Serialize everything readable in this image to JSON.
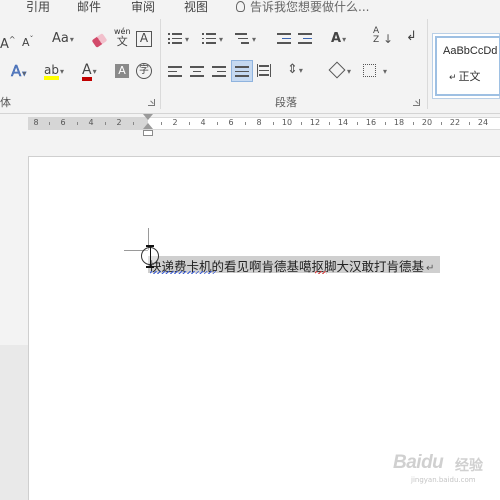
{
  "menu": {
    "tabs": [
      "引用",
      "邮件",
      "审阅",
      "视图"
    ],
    "tell_me": "告诉我您想要做什么..."
  },
  "ribbon": {
    "font_group_label": "体",
    "paragraph_group_label": "段落",
    "font_row1": {
      "grow": "A",
      "shrink": "A",
      "change_case": "Aa",
      "pinyin_top": "wén",
      "pinyin_bottom": "文",
      "char_border": "A"
    },
    "font_row2": {
      "text_effects": "A",
      "highlight": "ab",
      "font_color": "A",
      "char_shading": "A",
      "enclose": "字"
    },
    "para_row1": {
      "chinese_layout": "A",
      "sort": "A",
      "sort_sub": "Z",
      "show_marks": "↲"
    },
    "styles": {
      "preview": "AaBbCcDd",
      "name": "正文",
      "name_mark": "↵"
    }
  },
  "ruler": {
    "left_numbers": [
      "8",
      "6",
      "4",
      "2"
    ],
    "right_numbers": [
      "2",
      "4",
      "6",
      "8",
      "10",
      "12",
      "14",
      "16",
      "18",
      "20",
      "22",
      "24"
    ]
  },
  "document": {
    "text": "快递费卡机的看见啊肯德基噶抠脚大汉敢打肯德基",
    "paragraph_mark": "↵"
  },
  "watermark": {
    "brand": "Baidu",
    "sub": "经验",
    "url": "jingyan.baidu.com"
  },
  "colors": {
    "highlight": "#ffff00",
    "font_color": "#c00000",
    "selection": "#cfcfcf",
    "accent": "#9ec0e3"
  }
}
